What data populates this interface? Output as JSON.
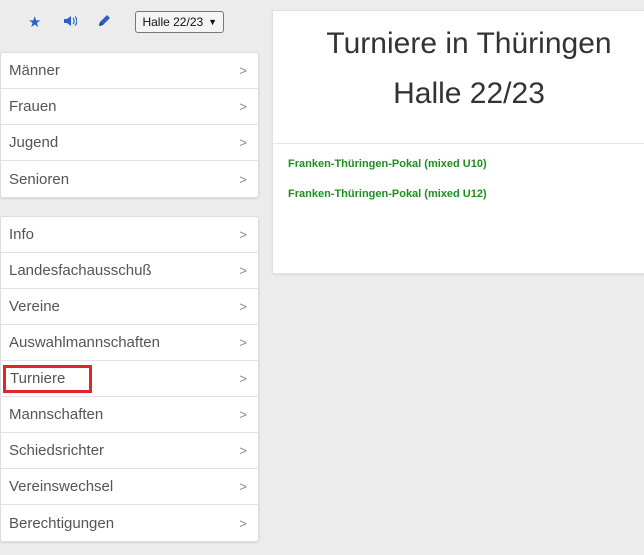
{
  "toolbar": {
    "icons": [
      "star-icon",
      "speaker-icon",
      "pencil-icon"
    ],
    "season": "Halle 22/23"
  },
  "menu_primary": [
    {
      "label": "Männer",
      "arrow": ">"
    },
    {
      "label": "Frauen",
      "arrow": ">"
    },
    {
      "label": "Jugend",
      "arrow": ">"
    },
    {
      "label": "Senioren",
      "arrow": ">"
    }
  ],
  "menu_secondary": [
    {
      "label": "Info",
      "arrow": ">"
    },
    {
      "label": "Landesfachausschuß",
      "arrow": ">"
    },
    {
      "label": "Vereine",
      "arrow": ">"
    },
    {
      "label": "Auswahlmannschaften",
      "arrow": ">"
    },
    {
      "label": "Turniere",
      "arrow": ">"
    },
    {
      "label": "Mannschaften",
      "arrow": ">"
    },
    {
      "label": "Schiedsrichter",
      "arrow": ">"
    },
    {
      "label": "Vereinswechsel",
      "arrow": ">"
    },
    {
      "label": "Berechtigungen",
      "arrow": ">"
    }
  ],
  "main": {
    "title_line1": "Turniere in Thüringen",
    "title_line2": "Halle 22/23",
    "tournaments": [
      "Franken-Thüringen-Pokal (mixed U10)",
      "Franken-Thüringen-Pokal (mixed U12)"
    ]
  },
  "colors": {
    "accent_blue": "#2b5fc6",
    "link_green": "#1e8e1e",
    "highlight_red": "#e0262b"
  }
}
